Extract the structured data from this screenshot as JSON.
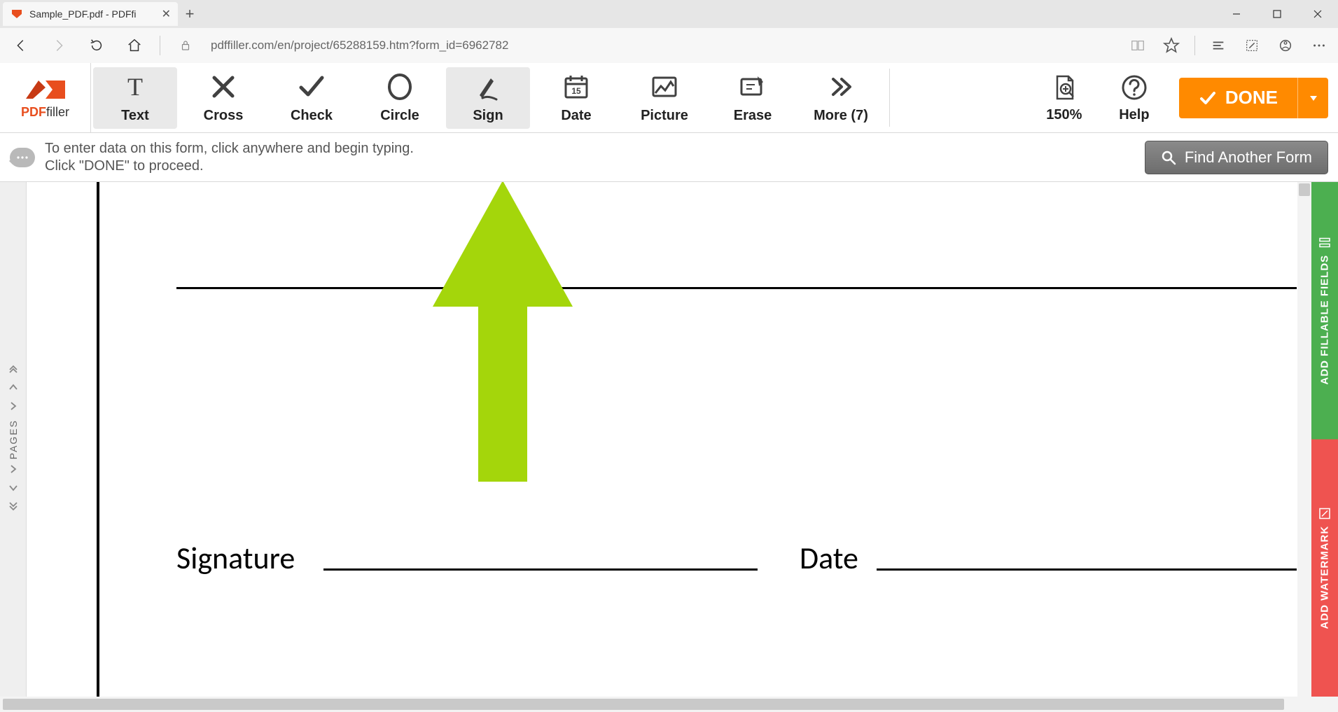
{
  "browser": {
    "tab_title": "Sample_PDF.pdf - PDFfi",
    "url": "pdffiller.com/en/project/65288159.htm?form_id=6962782"
  },
  "logo": {
    "pdf": "PDF",
    "filler": "filler"
  },
  "tools": {
    "text": "Text",
    "cross": "Cross",
    "check": "Check",
    "circle": "Circle",
    "sign": "Sign",
    "date": "Date",
    "picture": "Picture",
    "erase": "Erase",
    "more": "More (7)"
  },
  "right_tools": {
    "zoom": "150%",
    "help": "Help"
  },
  "done": {
    "label": "DONE"
  },
  "hint": {
    "line1": "To enter data on this form, click anywhere and begin typing.",
    "line2": "Click \"DONE\" to proceed."
  },
  "find_form": "Find Another Form",
  "left_rail": {
    "label": "PAGES"
  },
  "right_rail": {
    "fillable": "ADD FILLABLE FIELDS",
    "watermark": "ADD WATERMARK"
  },
  "document": {
    "signature_label": "Signature",
    "date_label": "Date"
  }
}
